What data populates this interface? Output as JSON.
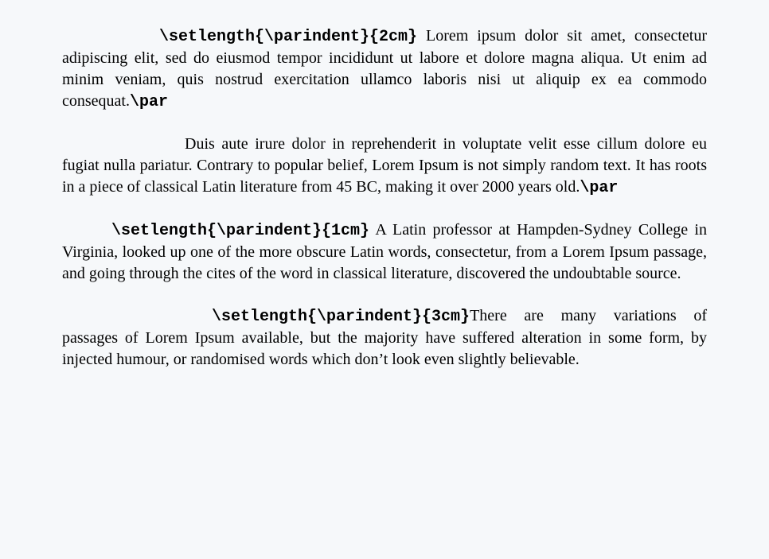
{
  "paragraphs": [
    {
      "cmd": "\\setlength{\\parindent}{2cm}",
      "body": "Lorem ipsum dolor sit amet, consectetur adipiscing elit, sed do eiusmod tempor incididunt ut labore et dolore magna aliqua. Ut enim ad minim veniam, quis nostrud exercitation ullamco laboris nisi ut aliquip ex ea commodo consequat.",
      "trailer": "\\par"
    },
    {
      "cmd": "",
      "body": "Duis aute irure dolor in reprehenderit in voluptate velit esse cillum dolore eu fugiat nulla pariatur. Contrary to popular belief, Lorem Ipsum is not simply random text. It has roots in a piece of classical Latin literature from 45 BC, making it over 2000 years old.",
      "trailer": "\\par"
    },
    {
      "cmd": "\\setlength{\\parindent}{1cm}",
      "body": "A Latin professor at Hampden-Sydney College in Virginia, looked up one of the more obscure Latin words, consectetur, from a Lorem Ipsum passage, and going through the cites of the word in classical literature, discovered the undoubtable source.",
      "trailer": ""
    },
    {
      "cmd": "\\setlength{\\parindent}{3cm}",
      "body": "There are many variations of passages of Lorem Ipsum available, but the majority have suffered alteration in some form, by injected humour, or randomised words which don’t look even slightly believable.",
      "trailer": ""
    }
  ]
}
